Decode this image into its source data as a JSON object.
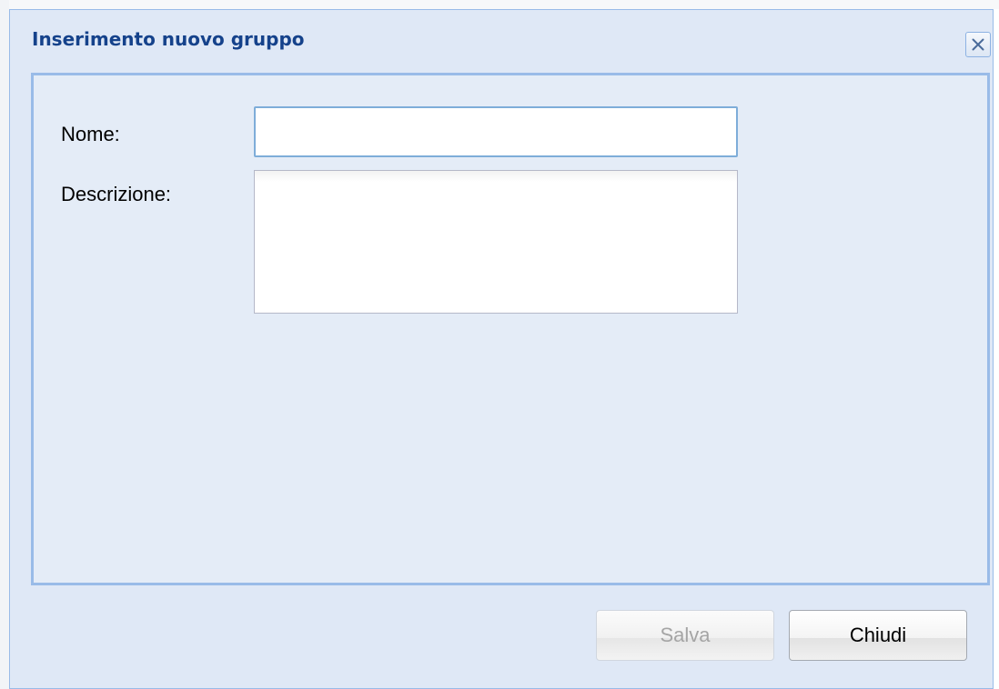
{
  "window": {
    "title": "Inserimento nuovo gruppo",
    "close_icon": "close-icon"
  },
  "form": {
    "name_label": "Nome:",
    "name_value": "",
    "description_label": "Descrizione:",
    "description_value": ""
  },
  "buttons": {
    "save_label": "Salva",
    "save_enabled": false,
    "close_label": "Chiudi"
  },
  "colors": {
    "title": "#15428b",
    "window_background": "#dfe8f6",
    "body_background": "#e4ecf7",
    "border_accent": "#99bbe8",
    "disabled_text": "#a5a5a5"
  }
}
